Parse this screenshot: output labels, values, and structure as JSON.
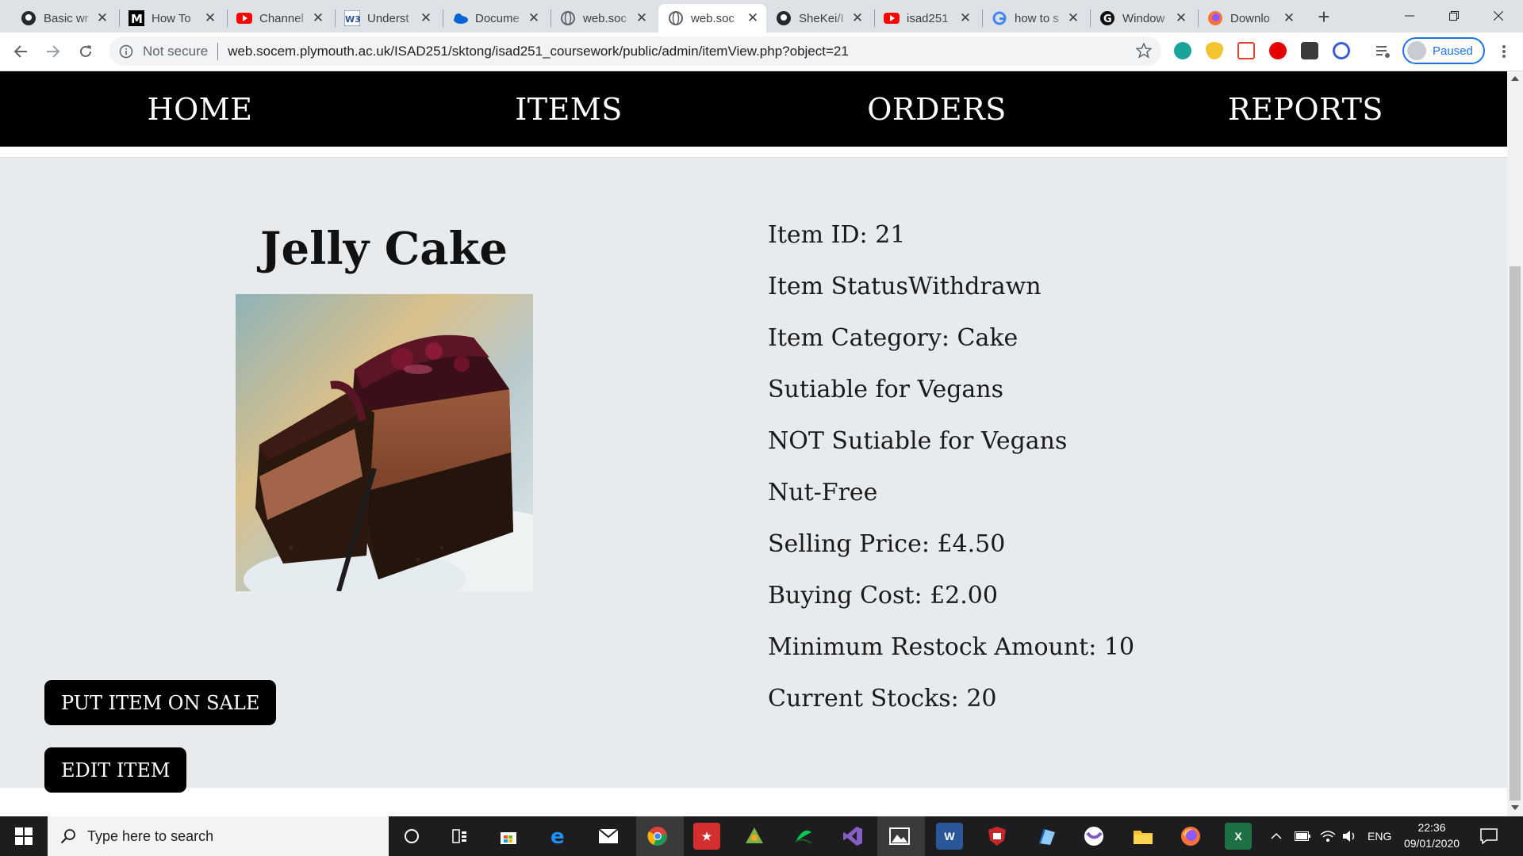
{
  "browser": {
    "tabs": [
      {
        "title": "Basic wr",
        "icon": "github-icon"
      },
      {
        "title": "How To",
        "icon": "medium-icon"
      },
      {
        "title": "Channel",
        "icon": "youtube-icon"
      },
      {
        "title": "Underst",
        "icon": "word-icon"
      },
      {
        "title": "Docume",
        "icon": "onedrive-icon"
      },
      {
        "title": "web.soc",
        "icon": "globe-icon"
      },
      {
        "title": "web.soc",
        "icon": "globe-icon",
        "active": true
      },
      {
        "title": "SheKei/I",
        "icon": "github-icon"
      },
      {
        "title": "isad251",
        "icon": "youtube-icon"
      },
      {
        "title": "how to s",
        "icon": "google-icon"
      },
      {
        "title": "Window",
        "icon": "g-icon"
      },
      {
        "title": "Downlo",
        "icon": "firefox-icon"
      }
    ],
    "security_label": "Not secure",
    "url": "web.socem.plymouth.ac.uk/ISAD251/sktong/isad251_coursework/public/admin/itemView.php?object=21",
    "profile_status": "Paused"
  },
  "site_nav": {
    "home": "HOME",
    "items": "ITEMS",
    "orders": "ORDERS",
    "reports": "REPORTS"
  },
  "item": {
    "name": "Jelly Cake",
    "image_alt": "chocolate cake slice",
    "put_on_sale_label": "PUT ITEM ON SALE",
    "edit_label": "EDIT ITEM",
    "details": [
      "Item ID: 21",
      "Item StatusWithdrawn",
      "Item Category: Cake",
      "Sutiable for Vegans",
      "NOT Sutiable for Vegans",
      "Nut-Free",
      "Selling Price: £4.50",
      "Buying Cost: £2.00",
      "Minimum Restock Amount: 10",
      "Current Stocks: 20"
    ]
  },
  "taskbar": {
    "search_placeholder": "Type here to search",
    "language": "ENG",
    "time": "22:36",
    "date": "09/01/2020",
    "apps": [
      "cortana-icon",
      "task-view-icon",
      "store-icon",
      "edge-icon",
      "mail-icon",
      "chrome-icon",
      "app-red-icon",
      "app-green-icon",
      "app-green2-icon",
      "visual-studio-icon",
      "photos-icon",
      "word-icon",
      "app-shield-icon",
      "app-blue-icon",
      "app-circle-icon",
      "file-explorer-icon",
      "firefox-icon",
      "excel-icon"
    ]
  }
}
